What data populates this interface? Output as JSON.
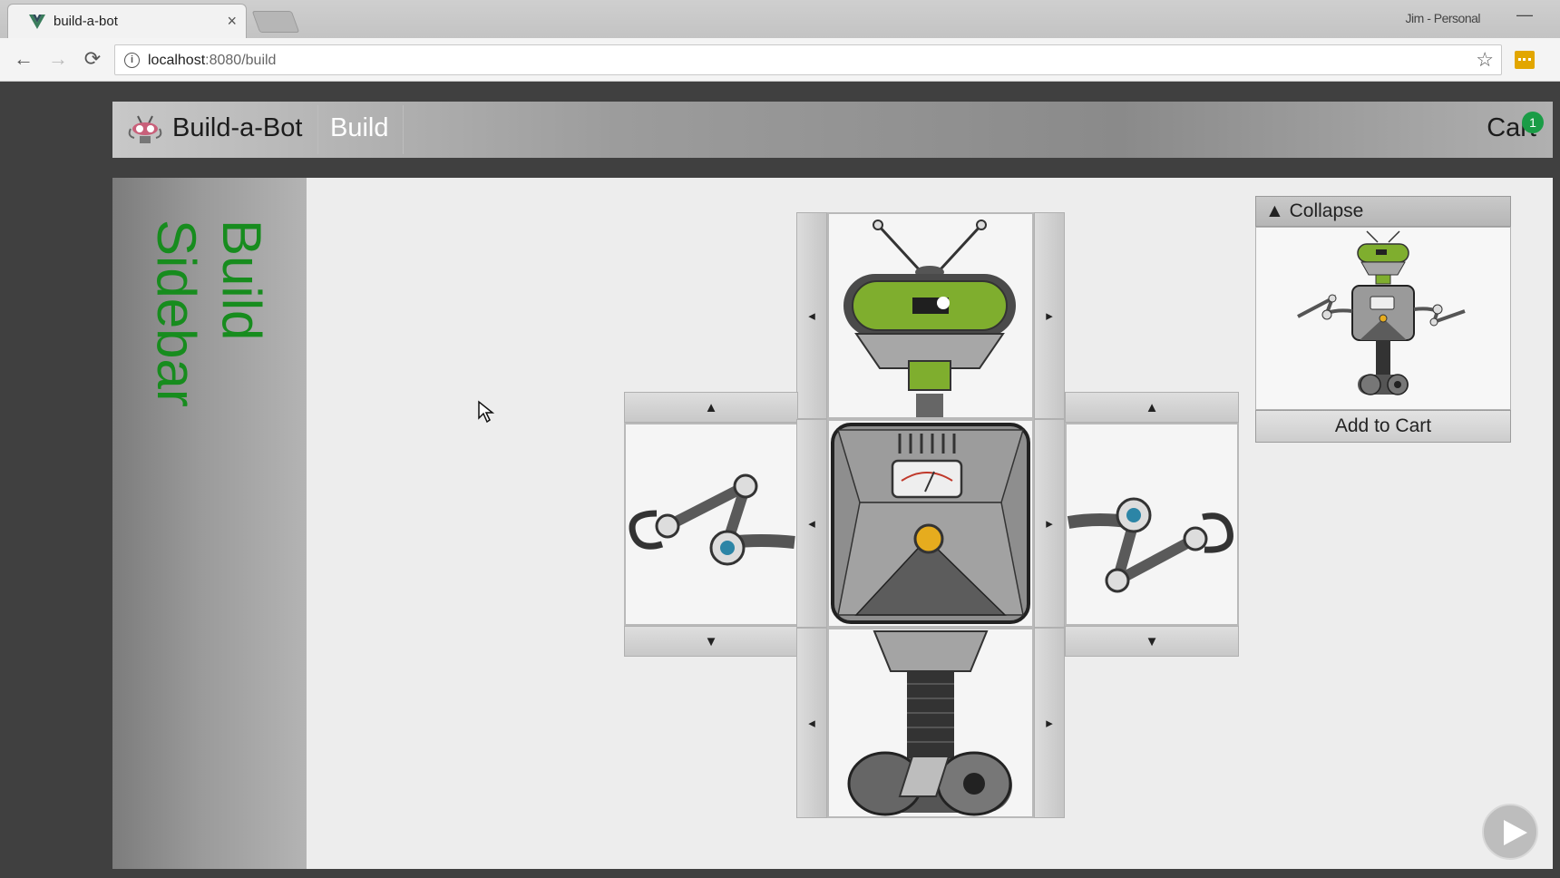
{
  "browser": {
    "tab_title": "build-a-bot",
    "tab_close": "×",
    "profile": "Jim - Personal",
    "minimize": "—",
    "back": "←",
    "forward": "→",
    "reload": "⟳",
    "info": "i",
    "url_host": "localhost",
    "url_path": ":8080/build",
    "bookmark": "☆",
    "extension_icon": "extension-icon"
  },
  "header": {
    "brand": "Build-a-Bot",
    "nav_build": "Build",
    "cart_label": "Cart",
    "cart_count": "1"
  },
  "sidebar": {
    "line1": "Build",
    "line2": "Sidebar"
  },
  "builder": {
    "head_prev": "◂",
    "head_next": "▸",
    "torso_prev": "◂",
    "torso_next": "▸",
    "base_prev": "◂",
    "base_next": "▸",
    "left_arm_up": "▲",
    "left_arm_down": "▼",
    "right_arm_up": "▲",
    "right_arm_down": "▼"
  },
  "preview": {
    "collapse_label": "▲ Collapse",
    "add_to_cart": "Add to Cart"
  },
  "colors": {
    "accent_green": "#178c1e",
    "badge_green": "#1a9c46",
    "head_green": "#7fae2e"
  }
}
